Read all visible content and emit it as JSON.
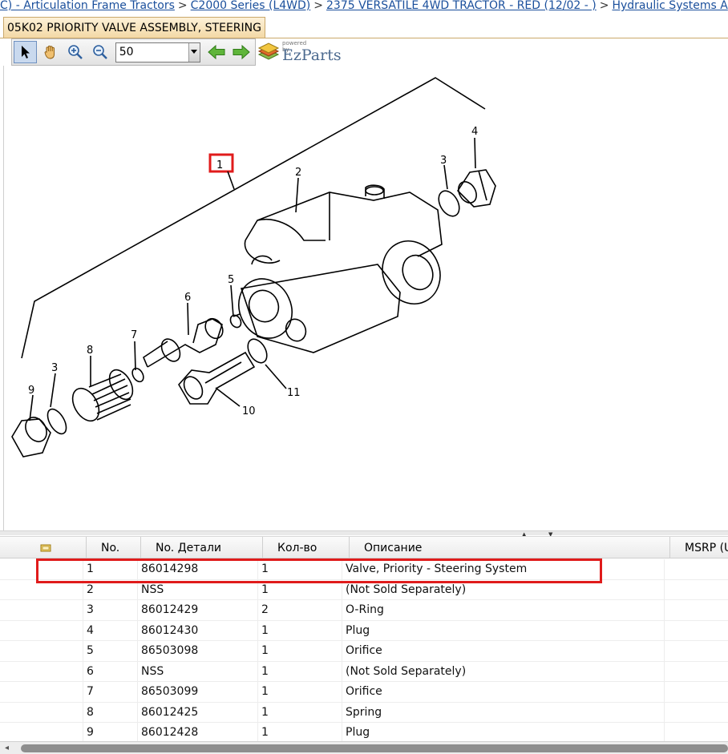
{
  "breadcrumb": [
    "C) - Articulation Frame Tractors",
    "C2000 Series (L4WD)",
    "2375 VERSATILE 4WD TRACTOR - RED (12/02 - )",
    "Hydraulic Systems A"
  ],
  "tab_title": "05K02 PRIORITY VALVE ASSEMBLY, STEERING",
  "toolbar": {
    "zoom_value": "50",
    "logo_small": "powered by",
    "logo_text": "EzParts"
  },
  "callouts": {
    "c1": "1",
    "c2": "2",
    "c3a": "3",
    "c3b": "3",
    "c4": "4",
    "c5": "5",
    "c6": "6",
    "c7": "7",
    "c8": "8",
    "c9": "9",
    "c10": "10",
    "c11": "11"
  },
  "colors": {
    "highlight": "#e01b1b",
    "tab_bg": "#f3d9a6",
    "link": "#1a4f9c"
  },
  "table": {
    "columns": {
      "no": "No.",
      "part": "No. Детали",
      "qty": "Кол-во",
      "desc": "Описание",
      "msrp": "MSRP (U"
    },
    "rows": [
      {
        "no": "1",
        "part": "86014298",
        "qty": "1",
        "desc": "Valve, Priority - Steering System"
      },
      {
        "no": "2",
        "part": "NSS",
        "qty": "1",
        "desc": "(Not Sold Separately)"
      },
      {
        "no": "3",
        "part": "86012429",
        "qty": "2",
        "desc": "O-Ring"
      },
      {
        "no": "4",
        "part": "86012430",
        "qty": "1",
        "desc": "Plug"
      },
      {
        "no": "5",
        "part": "86503098",
        "qty": "1",
        "desc": "Orifice"
      },
      {
        "no": "6",
        "part": "NSS",
        "qty": "1",
        "desc": "(Not Sold Separately)"
      },
      {
        "no": "7",
        "part": "86503099",
        "qty": "1",
        "desc": "Orifice"
      },
      {
        "no": "8",
        "part": "86012425",
        "qty": "1",
        "desc": "Spring"
      },
      {
        "no": "9",
        "part": "86012428",
        "qty": "1",
        "desc": "Plug"
      }
    ]
  }
}
